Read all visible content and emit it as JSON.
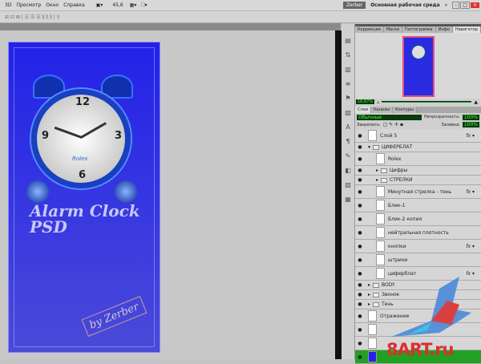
{
  "menubar": {
    "items": [
      "3D",
      "Просмотр",
      "Окно",
      "Справка"
    ],
    "zoom": "45,6",
    "user": "Zerber",
    "workspace": "Основная рабочая среда"
  },
  "navigator": {
    "tabs": [
      "Коррекция",
      "Маски",
      "Гистограмма",
      "Инфо",
      "Навигатор"
    ],
    "active": "Навигатор",
    "zoom": "16,67%"
  },
  "layers_panel": {
    "tabs": [
      "Слои",
      "Каналы",
      "Контуры"
    ],
    "blend_mode": "Обычные",
    "opacity_label": "Непрозрачность:",
    "opacity": "100%",
    "lock_label": "Закрепить:",
    "fill_label": "Заливка:",
    "fill": "100%"
  },
  "layers": [
    {
      "name": "Слой 5",
      "type": "layer",
      "fx": true
    },
    {
      "name": "ЦИФЕРБЛАТ",
      "type": "group",
      "open": true
    },
    {
      "name": "Rolex",
      "type": "layer"
    },
    {
      "name": "Цифры",
      "type": "group"
    },
    {
      "name": "СТРЕЛКИ",
      "type": "group"
    },
    {
      "name": "Минутная стрелка - тень",
      "type": "layer",
      "fx": true
    },
    {
      "name": "Блик-1",
      "type": "layer"
    },
    {
      "name": "Блик-2 копия",
      "type": "layer"
    },
    {
      "name": "нейтральная плотность",
      "type": "layer"
    },
    {
      "name": "кнопки",
      "type": "layer",
      "fx": true
    },
    {
      "name": "штрихи",
      "type": "layer"
    },
    {
      "name": "циферблат",
      "type": "layer",
      "fx": true
    },
    {
      "name": "BODY",
      "type": "group"
    },
    {
      "name": "Звонок",
      "type": "group"
    },
    {
      "name": "Тень",
      "type": "group"
    },
    {
      "name": "Отражение",
      "type": "layer"
    },
    {
      "name": "",
      "type": "layer"
    },
    {
      "name": "",
      "type": "layer"
    },
    {
      "name": "",
      "type": "background",
      "selected": true
    }
  ],
  "artwork": {
    "title1": "Alarm Clock",
    "title2": "PSD",
    "brand": "Rolex",
    "signature": "by Zerber",
    "numbers": [
      "12",
      "3",
      "6",
      "9"
    ]
  },
  "watermark": "8ART.ru",
  "colors": {
    "doc_blue": "#2222e8",
    "selected_layer": "#22a022"
  }
}
